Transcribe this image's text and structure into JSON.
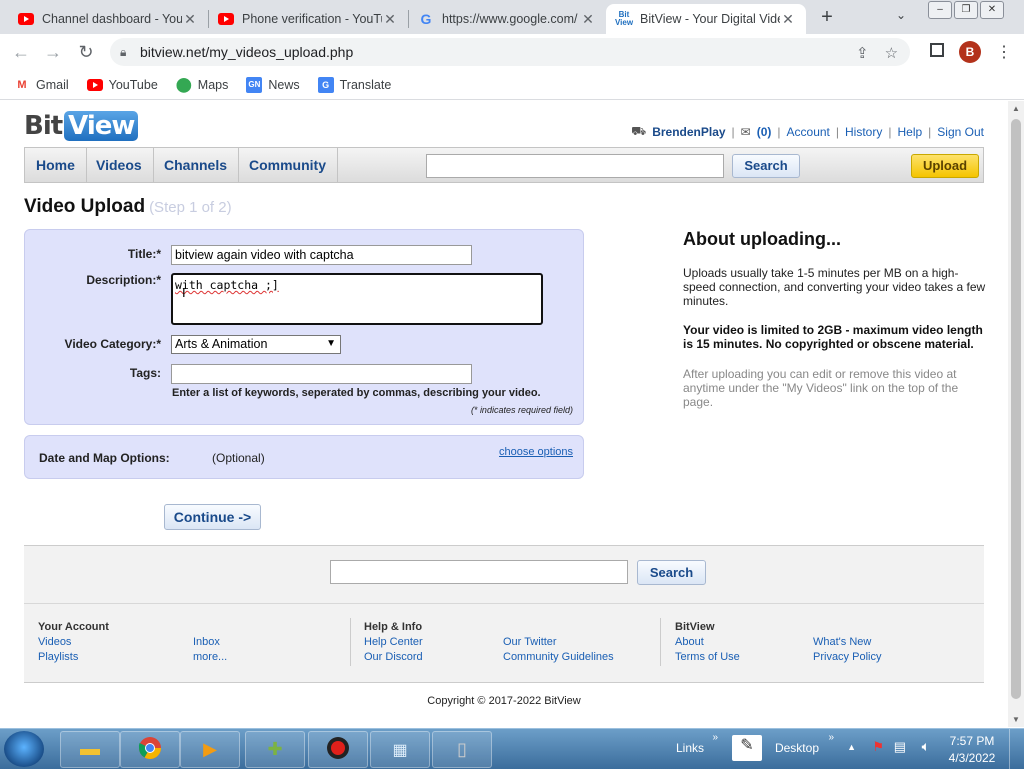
{
  "browser": {
    "tabs": [
      {
        "title": "Channel dashboard - YouTube",
        "icon": "youtube-icon"
      },
      {
        "title": "Phone verification - YouTube",
        "icon": "youtube-icon"
      },
      {
        "title": "https://www.google.com/",
        "icon": "google-icon"
      },
      {
        "title": "BitView - Your Digital Video",
        "icon": "bitview-icon"
      }
    ],
    "url": "bitview.net/my_videos_upload.php",
    "avatar_letter": "B",
    "bookmarks": [
      {
        "label": "Gmail"
      },
      {
        "label": "YouTube"
      },
      {
        "label": "Maps"
      },
      {
        "label": "News"
      },
      {
        "label": "Translate"
      }
    ]
  },
  "site": {
    "logo_bit": "Bit",
    "logo_view": "View",
    "username": "BrendenPlay",
    "inbox_count": "(0)",
    "user_links": [
      "Account",
      "History",
      "Help",
      "Sign Out"
    ],
    "nav": [
      "Home",
      "Videos",
      "Channels",
      "Community"
    ],
    "search_label": "Search",
    "upload_label": "Upload"
  },
  "upload": {
    "heading": "Video Upload",
    "step": "(Step 1 of 2)",
    "title_label": "Title:*",
    "title_value": "bitview again video with captcha",
    "description_label": "Description:*",
    "description_value": "with captcha ;]",
    "category_label": "Video Category:*",
    "category_value": "Arts & Animation",
    "tags_label": "Tags:",
    "tags_value": "",
    "tags_hint": "Enter a list of keywords, seperated by commas, describing your video.",
    "required_note": "(* indicates required field)",
    "date_map_label": "Date and Map Options:",
    "optional": "(Optional)",
    "choose_options": "choose options",
    "continue_label": "Continue ->"
  },
  "about": {
    "heading": "About uploading...",
    "p1": "Uploads usually take 1-5 minutes per MB on a high-speed connection, and converting your video takes a few minutes.",
    "p2": "Your video is limited to 2GB - maximum video length is 15 minutes. No copyrighted or obscene material.",
    "p3": "After uploading you can edit or remove this video at anytime under the \"My Videos\" link on the top of the page."
  },
  "footer": {
    "search_label": "Search",
    "your_account": {
      "heading": "Your Account",
      "links": [
        "Videos",
        "Playlists",
        "Inbox",
        "more..."
      ]
    },
    "help_info": {
      "heading": "Help & Info",
      "links": [
        "Help Center",
        "Our Discord",
        "Our Twitter",
        "Community Guidelines"
      ]
    },
    "bitview": {
      "heading": "BitView",
      "links": [
        "About",
        "Terms of Use",
        "What's New",
        "Privacy Policy"
      ]
    },
    "copyright": "Copyright © 2017-2022 BitView"
  },
  "taskbar": {
    "links_label": "Links",
    "desktop_label": "Desktop",
    "time": "7:57 PM",
    "date": "4/3/2022"
  },
  "colors": {
    "link": "#1a5fb4",
    "form_bg": "#dfe2fb",
    "upload_button": "#f5c400"
  }
}
